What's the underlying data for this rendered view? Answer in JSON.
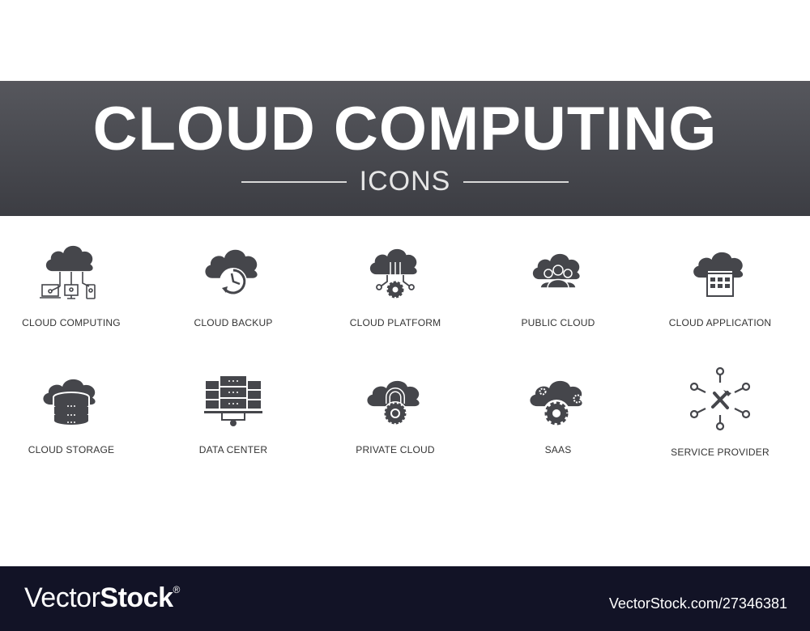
{
  "header": {
    "title": "CLOUD COMPUTING",
    "subtitle": "ICONS"
  },
  "icon_color": "#45464b",
  "icons": [
    {
      "label": "CLOUD COMPUTING",
      "icon": "cloud-devices-icon"
    },
    {
      "label": "CLOUD BACKUP",
      "icon": "cloud-clock-icon"
    },
    {
      "label": "CLOUD PLATFORM",
      "icon": "cloud-gear-circuit-icon"
    },
    {
      "label": "PUBLIC CLOUD",
      "icon": "cloud-people-icon"
    },
    {
      "label": "CLOUD APPLICATION",
      "icon": "cloud-app-window-icon"
    },
    {
      "label": "CLOUD STORAGE",
      "icon": "cloud-database-icon"
    },
    {
      "label": "DATA CENTER",
      "icon": "server-rack-icon"
    },
    {
      "label": "PRIVATE CLOUD",
      "icon": "cloud-lock-icon"
    },
    {
      "label": "SAAS",
      "icon": "cloud-gears-icon"
    },
    {
      "label": "SERVICE PROVIDER",
      "icon": "tools-network-icon"
    }
  ],
  "footer": {
    "logo_light": "Vector",
    "logo_bold": "Stock",
    "logo_mark": "®",
    "reference": "VectorStock.com/27346381",
    "background": "#121326"
  }
}
